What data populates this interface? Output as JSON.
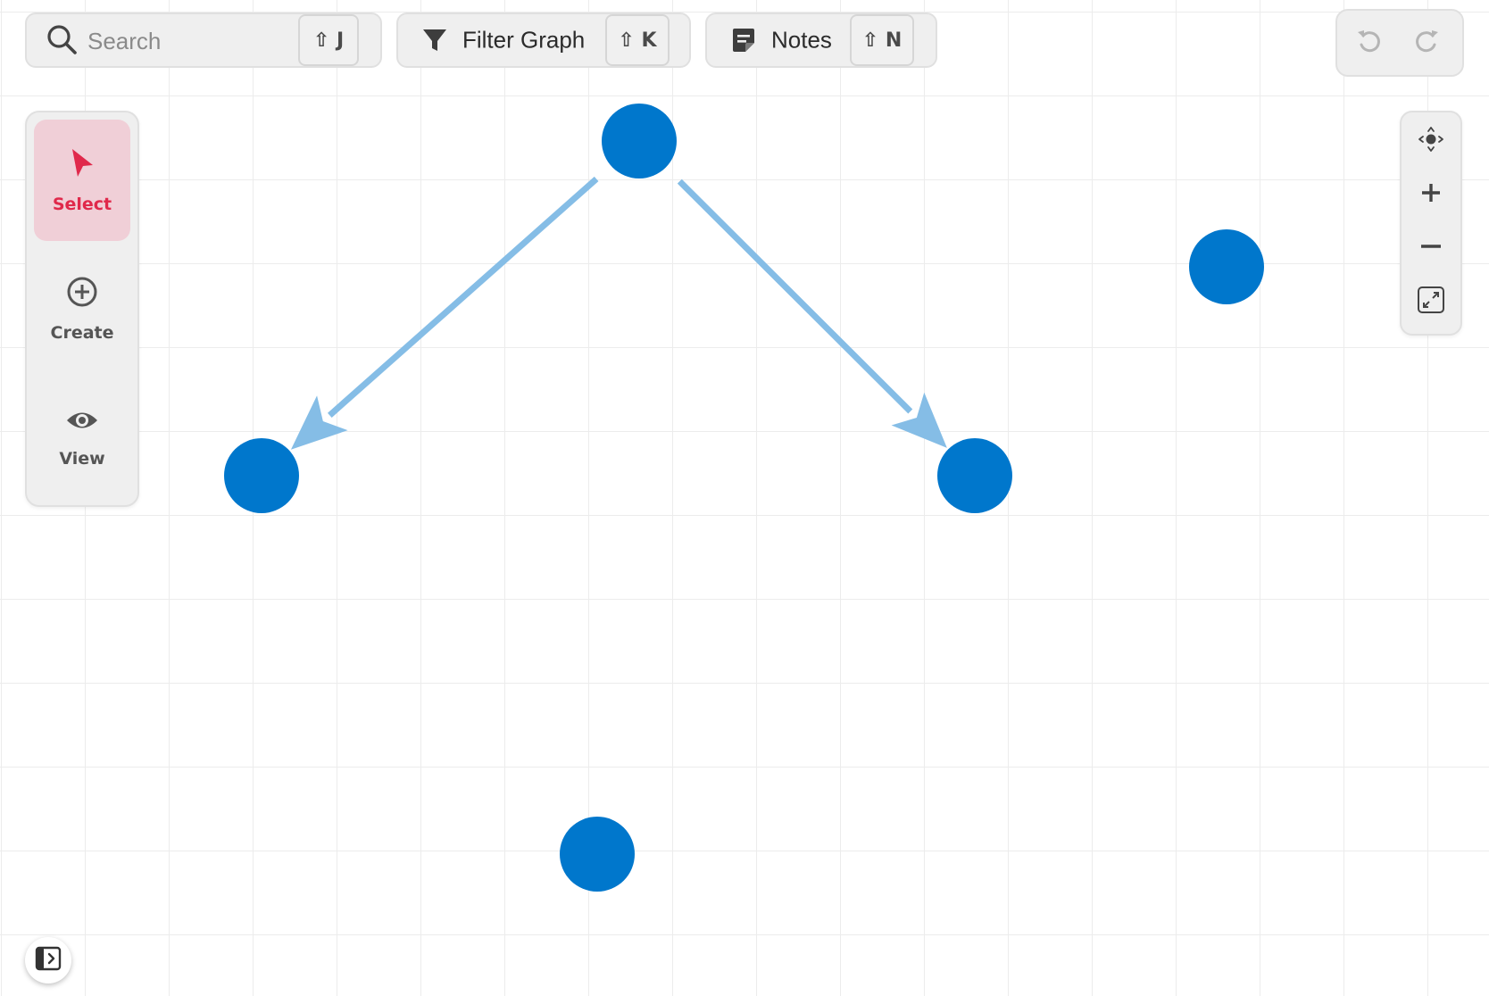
{
  "topbar": {
    "search": {
      "placeholder": "Search",
      "value": "",
      "shortcut": "⇧ J",
      "icon": "search-icon"
    },
    "filter": {
      "label": "Filter Graph",
      "shortcut": "⇧ K",
      "icon": "filter-icon"
    },
    "notes": {
      "label": "Notes",
      "shortcut": "⇧ N",
      "icon": "notes-icon"
    }
  },
  "history": {
    "undo_icon": "undo-icon",
    "redo_icon": "redo-icon"
  },
  "toolbar": {
    "tools": [
      {
        "label": "Select",
        "icon": "cursor-icon",
        "active": true
      },
      {
        "label": "Create",
        "icon": "plus-circle-icon",
        "active": false
      },
      {
        "label": "View",
        "icon": "eye-icon",
        "active": false
      }
    ]
  },
  "zoom_controls": [
    "recenter-icon",
    "zoom-in-icon",
    "zoom-out-icon",
    "fit-screen-icon"
  ],
  "sidebar_toggle_icon": "sidebar-toggle-icon",
  "graph": {
    "node_color": "#0077cc",
    "edge_color": "#85bde6",
    "nodes": [
      {
        "id": "n1"
      },
      {
        "id": "n2"
      },
      {
        "id": "n3"
      },
      {
        "id": "n4"
      },
      {
        "id": "n5"
      }
    ],
    "edges": [
      {
        "from": "n1",
        "to": "n2"
      },
      {
        "from": "n1",
        "to": "n3"
      }
    ]
  },
  "colors": {
    "accent": "#e0294b",
    "accent_bg": "#f0cfd7",
    "panel_bg": "#efefef"
  }
}
